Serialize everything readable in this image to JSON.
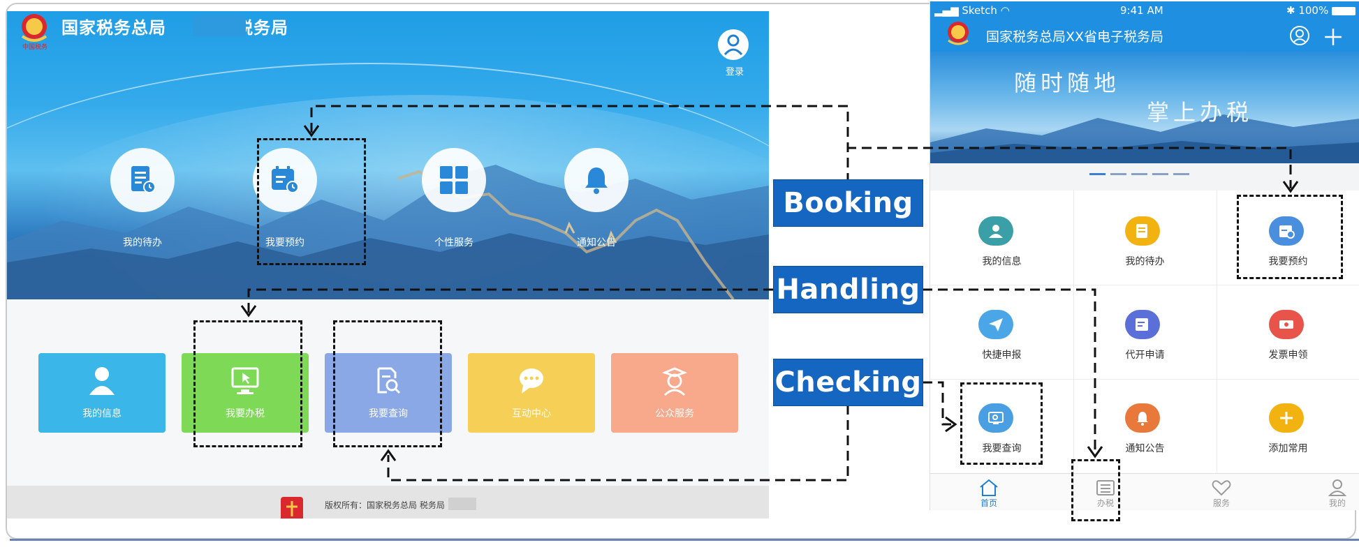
{
  "desktop": {
    "header": {
      "title_left": "国家税务总局",
      "title_right": "电子税务局",
      "login_label": "登录"
    },
    "quick_actions": [
      {
        "label": "我的待办",
        "icon": "document-clock-icon"
      },
      {
        "label": "我要预约",
        "icon": "calendar-clock-icon"
      },
      {
        "label": "个性服务",
        "icon": "grid-icon"
      },
      {
        "label": "通知公告",
        "icon": "bell-icon"
      }
    ],
    "tiles": [
      {
        "label": "我的信息",
        "icon": "user-icon",
        "color": "#3bb6e8"
      },
      {
        "label": "我要办税",
        "icon": "monitor-icon",
        "color": "#7ed957"
      },
      {
        "label": "我要查询",
        "icon": "search-document-icon",
        "color": "#8aa7e6"
      },
      {
        "label": "互动中心",
        "icon": "chat-icon",
        "color": "#f6cf56"
      },
      {
        "label": "公众服务",
        "icon": "person-icon",
        "color": "#f8a88b"
      }
    ],
    "footer": {
      "copyright": "版权所有：国家税务总局        税务局"
    }
  },
  "mobile": {
    "status_bar": {
      "carrier": "Sketch",
      "time": "9:41 AM",
      "battery": "100%"
    },
    "header_title": "国家税务总局XX省电子税务局",
    "banner": {
      "line1": "随时随地",
      "line2": "掌上办税"
    },
    "grid": [
      {
        "label": "我的信息",
        "icon": "user-card-icon",
        "color": "#3a9fa6"
      },
      {
        "label": "我的待办",
        "icon": "document-icon",
        "color": "#f2b20f"
      },
      {
        "label": "我要预约",
        "icon": "calendar-icon",
        "color": "#4a8fde"
      },
      {
        "label": "快捷申报",
        "icon": "paper-plane-icon",
        "color": "#4aa6e6"
      },
      {
        "label": "代开申请",
        "icon": "form-icon",
        "color": "#5b6fd9"
      },
      {
        "label": "发票申领",
        "icon": "ticket-icon",
        "color": "#e8534a"
      },
      {
        "label": "我要查询",
        "icon": "monitor-search-icon",
        "color": "#4a9fe3"
      },
      {
        "label": "通知公告",
        "icon": "bell-icon",
        "color": "#e8793a"
      },
      {
        "label": "添加常用",
        "icon": "plus-icon",
        "color": "#f2b20f"
      }
    ],
    "tab_bar": [
      {
        "label": "首页",
        "icon": "home-icon"
      },
      {
        "label": "办税",
        "icon": "list-icon"
      },
      {
        "label": "服务",
        "icon": "heart-icon"
      },
      {
        "label": "我的",
        "icon": "user-outline-icon"
      }
    ]
  },
  "annotations": {
    "booking": "Booking",
    "handling": "Handling",
    "checking": "Checking"
  }
}
